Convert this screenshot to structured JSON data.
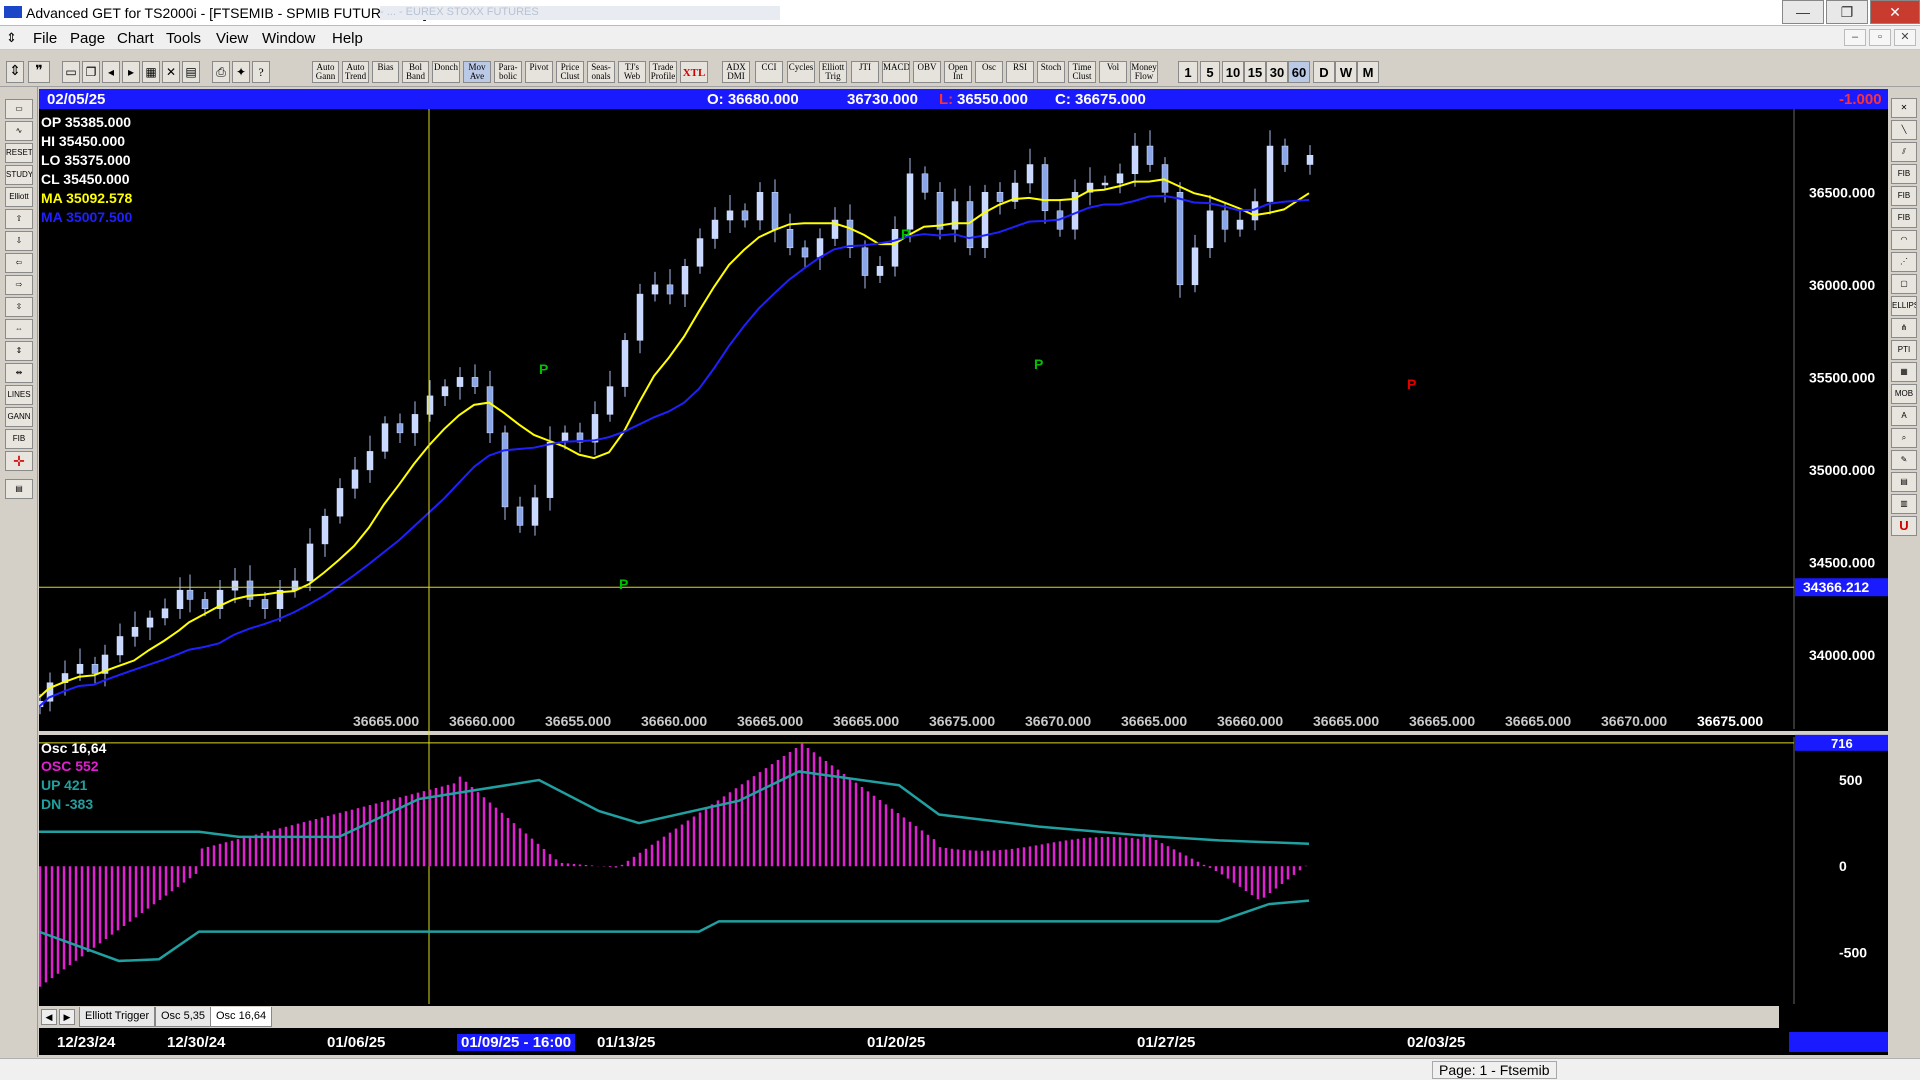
{
  "window": {
    "title": "Advanced GET for TS2000i - [FTSEMIB - SPMIB FUTURES, 60]",
    "blurred_text": "- ... - EUREX STOXX FUTURES",
    "min_label": "—",
    "max_label": "❐",
    "close_label": "✕"
  },
  "menu": [
    "File",
    "Page",
    "Chart",
    "Tools",
    "View",
    "Window",
    "Help"
  ],
  "mdi": {
    "min": "–",
    "restore": "▫",
    "close": "✕"
  },
  "toolbar": {
    "indicators": [
      {
        "label": "Auto Gann"
      },
      {
        "label": "Auto Trend"
      },
      {
        "label": "Bias"
      },
      {
        "label": "Bol Band"
      },
      {
        "label": "Donch"
      },
      {
        "label": "Mov Ave"
      },
      {
        "label": "Para- bolic"
      },
      {
        "label": "Pivot"
      },
      {
        "label": "Price Clust"
      },
      {
        "label": "Seas- onals"
      },
      {
        "label": "TJ's Web"
      },
      {
        "label": "Trade Profile"
      },
      {
        "label": "XTL"
      },
      {
        "label": "ADX DMI"
      },
      {
        "label": "CCI"
      },
      {
        "label": "Cycles"
      },
      {
        "label": "Elliott Trig"
      },
      {
        "label": "JTI"
      },
      {
        "label": "MACD"
      },
      {
        "label": "OBV"
      },
      {
        "label": "Open Int"
      },
      {
        "label": "Osc"
      },
      {
        "label": "RSI"
      },
      {
        "label": "Stoch"
      },
      {
        "label": "Time Clust"
      },
      {
        "label": "Vol"
      },
      {
        "label": "Money Flow"
      }
    ],
    "periods": [
      "1",
      "5",
      "10",
      "15",
      "30",
      "60",
      "D",
      "W",
      "M"
    ],
    "active_period": "60"
  },
  "infobar": {
    "date": "02/05/25",
    "open": "O: 36680.000",
    "high": "36730.000",
    "low_label": "L:",
    "low": "36550.000",
    "close": "C: 36675.000",
    "change": "-1.000"
  },
  "legend": [
    {
      "name": "OP",
      "value": "35385.000",
      "color": "#ffffff"
    },
    {
      "name": "HI",
      "value": "35450.000",
      "color": "#ffffff"
    },
    {
      "name": "LO",
      "value": "35375.000",
      "color": "#ffffff"
    },
    {
      "name": "CL",
      "value": "35450.000",
      "color": "#ffffff"
    },
    {
      "name": "MA",
      "value": "35092.578",
      "color": "#ffff00"
    },
    {
      "name": "MA",
      "value": "35007.500",
      "color": "#2020ff"
    }
  ],
  "price_axis": [
    "36500.000",
    "36000.000",
    "35500.000",
    "35000.000",
    "34500.000",
    "34000.000"
  ],
  "crosshair_price": "34366.212",
  "bottom_prices": [
    "36665.000",
    "36660.000",
    "36655.000",
    "36660.000",
    "36665.000",
    "36665.000",
    "36675.000",
    "36670.000",
    "36665.000",
    "36660.000",
    "36665.000",
    "36665.000",
    "36665.000",
    "36670.000",
    "36675.000"
  ],
  "pivots": [
    {
      "label": "P",
      "color": "#00c000"
    },
    {
      "label": "P",
      "color": "#00c000"
    },
    {
      "label": "P",
      "color": "#00c000"
    },
    {
      "label": "P",
      "color": "#00c000"
    },
    {
      "label": "P",
      "color": "#e00000"
    }
  ],
  "osc": {
    "title": "Osc 16,64",
    "osc_label": "OSC",
    "osc_value": "552",
    "up_label": "UP",
    "up_value": "421",
    "dn_label": "DN",
    "dn_value": "-383",
    "axis": [
      "500",
      "0",
      "-500"
    ],
    "current": "716",
    "colors": {
      "bars": "#e020d0",
      "bands": "#20a0a0"
    }
  },
  "tabs": [
    "Elliott Trigger",
    "Osc 5,35",
    "Osc 16,64"
  ],
  "active_tab": "Osc 16,64",
  "dates": [
    "12/23/24",
    "12/30/24",
    "01/06/25",
    "01/09/25 - 16:00",
    "01/13/25",
    "01/20/25",
    "01/27/25",
    "02/03/25"
  ],
  "highlight_date": "01/09/25 - 16:00",
  "status": {
    "page": "Page: 1 - Ftsemib"
  },
  "chart_data": {
    "type": "candlestick",
    "ylim": [
      33600,
      36950
    ],
    "series": [
      {
        "name": "MA",
        "color": "#ffff00"
      },
      {
        "name": "MA",
        "color": "#2020ff"
      }
    ],
    "osc_ylim": [
      -800,
      750
    ]
  }
}
